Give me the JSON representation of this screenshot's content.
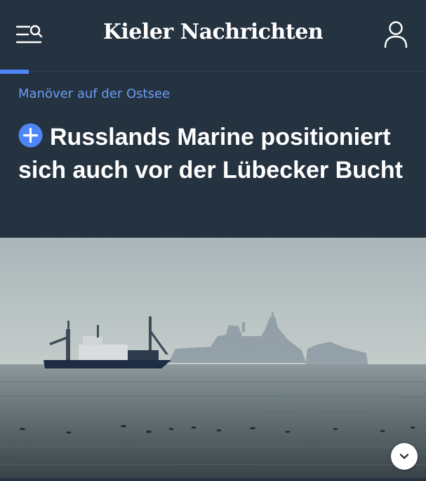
{
  "header": {
    "logo": "Kieler Nachrichten",
    "menu_icon": "menu-search-icon",
    "user_icon": "user-icon"
  },
  "article": {
    "kicker": "Manöver auf der Ostsee",
    "badge_icon": "plus-circle-icon",
    "title": "Russlands Marine positioniert sich auch vor der Lübecker Bucht",
    "image_icon": "chevron-down-icon"
  },
  "colors": {
    "header_bg": "#253340",
    "accent": "#4f86f7",
    "kicker": "#6a9cf5"
  }
}
